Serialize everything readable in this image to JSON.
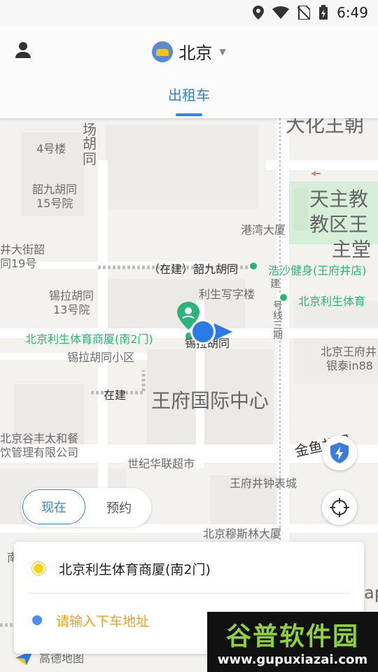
{
  "status": {
    "time": "6:49"
  },
  "header": {
    "city": "北京",
    "tab": "出租车"
  },
  "map": {
    "labels": {
      "l1": "场",
      "l2": "胡",
      "l3": "同",
      "l4": "4号楼",
      "l5": "韶九胡同",
      "l6": "15号院",
      "l7": "大化王朝",
      "l8": "天主教",
      "l9": "教区王",
      "l10": "主堂",
      "l11": "港湾大厦",
      "l12": "井大街韶",
      "l13": "同19号",
      "l14": "（在建）韶九胡同",
      "l15": "浩沙健身(王府井店)",
      "l16": "锡拉胡同",
      "l17": "13号院",
      "l18": "利生写字楼",
      "l19": "北京利生体育",
      "l20": "北京利生体育商厦(南2门)",
      "l21": "锡拉胡同",
      "l22": "锡拉胡同小区",
      "l23": "北京王府井",
      "l24": "银泰in88",
      "l25": "在建",
      "l26": "王府国际中心",
      "l27": "北京谷丰太和餐",
      "l28": "饮管理有限公司",
      "l29": "金鱼胡同",
      "l30": "世纪华联超市",
      "l31": "王府井钟表城",
      "l32": "北京穆斯林大厦",
      "l33": "建",
      "l34": "号线三期",
      "l35": "高德地图",
      "l36": "南",
      "l37": "ap"
    }
  },
  "time_toggle": {
    "now": "现在",
    "later": "预约"
  },
  "route": {
    "pickup": "北京利生体育商厦(南2门)",
    "dropoff_placeholder": "请输入下车地址"
  },
  "watermark": {
    "main": "谷普软件园",
    "sub": "www.gupuxiazai.com"
  },
  "colors": {
    "accent": "#3385d9",
    "pickup_dot": "#f7d21a",
    "dropoff_dot": "#4a8ff0",
    "poi_green": "#2bb57a"
  },
  "icons": {
    "user": "user-icon",
    "logo": "taxi-logo-icon",
    "shield": "shield-bolt-icon",
    "locate": "locate-crosshair-icon"
  }
}
